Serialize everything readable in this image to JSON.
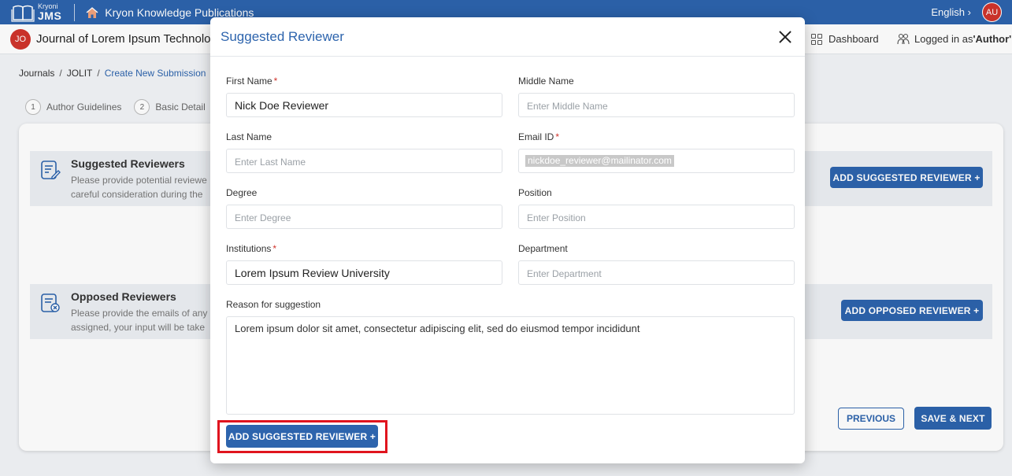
{
  "topbar": {
    "brand_small": "Kryoni",
    "brand_big": "JMS",
    "publisher": "Kryon Knowledge Publications",
    "language": "English",
    "user_initials": "AU"
  },
  "journalbar": {
    "journal_initials": "JO",
    "journal_title": "Journal of Lorem Ipsum Technolog",
    "dashboard_label": "Dashboard",
    "logged_prefix": "Logged in as ",
    "logged_role": "'Author'"
  },
  "breadcrumb": {
    "items": [
      "Journals",
      "JOLIT",
      "Create New Submission"
    ]
  },
  "steps": [
    {
      "num": "1",
      "label": "Author Guidelines"
    },
    {
      "num": "2",
      "label": "Basic Detail"
    }
  ],
  "sections": {
    "suggested": {
      "title": "Suggested Reviewers",
      "desc_line1": "Please provide potential reviewe",
      "desc_line2": "careful consideration during the",
      "button": "ADD SUGGESTED REVIEWER +"
    },
    "opposed": {
      "title": "Opposed Reviewers",
      "desc_line1": "Please provide the emails of any",
      "desc_line2": "assigned, your input will be take",
      "button": "ADD OPPOSED REVIEWER +"
    }
  },
  "footer_buttons": {
    "previous": "PREVIOUS",
    "save_next": "SAVE & NEXT"
  },
  "modal": {
    "title": "Suggested Reviewer",
    "fields": {
      "first_name": {
        "label": "First Name",
        "required": "*",
        "value": "Nick Doe Reviewer",
        "placeholder": ""
      },
      "middle_name": {
        "label": "Middle Name",
        "value": "",
        "placeholder": "Enter Middle Name"
      },
      "last_name": {
        "label": "Last Name",
        "value": "",
        "placeholder": "Enter Last Name"
      },
      "email": {
        "label": "Email ID",
        "required": "*",
        "value": "nickdoe_reviewer@mailinator.com"
      },
      "degree": {
        "label": "Degree",
        "value": "",
        "placeholder": "Enter Degree"
      },
      "position": {
        "label": "Position",
        "value": "",
        "placeholder": "Enter Position"
      },
      "institutions": {
        "label": "Institutions",
        "required": "*",
        "value": "Lorem Ipsum Review University"
      },
      "department": {
        "label": "Department",
        "value": "",
        "placeholder": "Enter Department"
      },
      "reason": {
        "label": "Reason for suggestion",
        "value": "Lorem ipsum dolor sit amet, consectetur adipiscing elit, sed do eiusmod tempor incididunt"
      }
    },
    "submit_button": "ADD SUGGESTED REVIEWER +"
  },
  "colors": {
    "primary": "#2d64ad",
    "avatar": "#d0342c",
    "highlight": "#e0141e"
  }
}
